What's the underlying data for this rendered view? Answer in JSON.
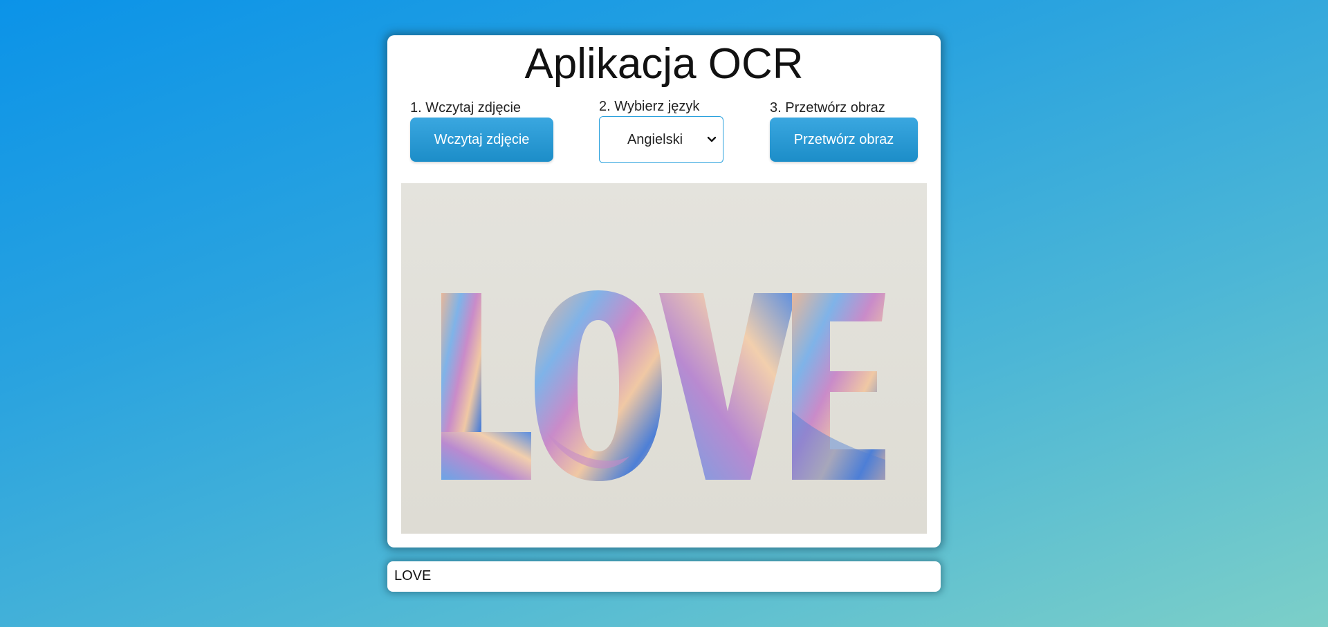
{
  "app": {
    "title": "Aplikacja OCR"
  },
  "steps": {
    "upload": {
      "label": "1. Wczytaj zdjęcie",
      "button_label": "Wczytaj zdjęcie"
    },
    "language": {
      "label": "2. Wybierz język",
      "selected": "Angielski"
    },
    "process": {
      "label": "3. Przetwórz obraz",
      "button_label": "Przetwórz obraz"
    }
  },
  "preview": {
    "image_text": "LOVE",
    "icon": "uploaded-image"
  },
  "result": {
    "text": "LOVE"
  },
  "colors": {
    "accent": "#1c8dc8",
    "background_start": "#0b93e8",
    "background_end": "#7ccfc8"
  }
}
